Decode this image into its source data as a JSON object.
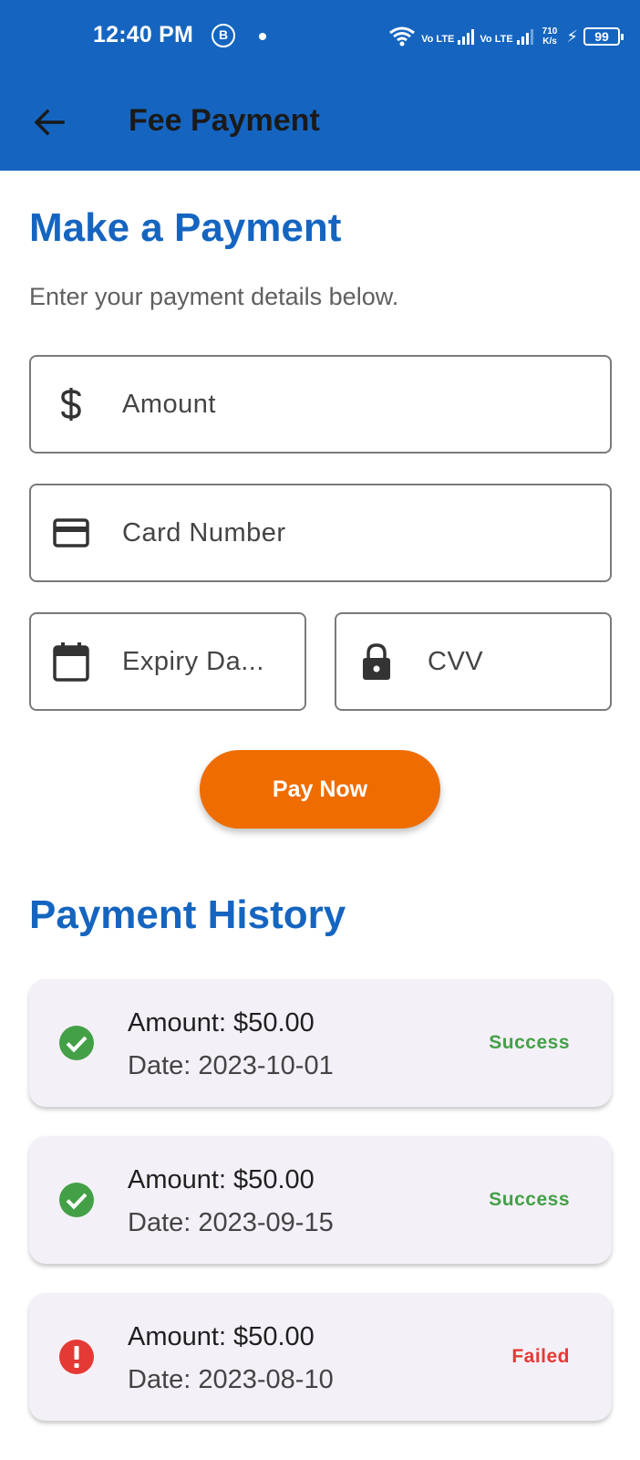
{
  "statusbar": {
    "time": "12:40 PM",
    "app_badge": "B",
    "sim1_label": "Vo LTE",
    "sim2_label": "Vo LTE",
    "speed_value": "710",
    "speed_unit": "K/s",
    "battery": "99"
  },
  "appbar": {
    "title": "Fee Payment",
    "back_icon": "arrow-back-icon",
    "color": "#1565c0"
  },
  "payment_form": {
    "title": "Make a Payment",
    "subtitle": "Enter your payment details below.",
    "amount_placeholder": "Amount",
    "card_number_placeholder": "Card Number",
    "expiry_placeholder": "Expiry Da...",
    "cvv_placeholder": "CVV",
    "amount_icon": "dollar-icon",
    "card_icon": "credit-card-icon",
    "expiry_icon": "calendar-icon",
    "cvv_icon": "lock-icon",
    "pay_button_label": "Pay Now",
    "pay_button_color": "#ef6c00"
  },
  "history": {
    "title": "Payment History",
    "items": [
      {
        "amount": "Amount: $50.00",
        "date": "Date: 2023-10-01",
        "status": "Success",
        "icon": "check-circle-icon",
        "color": "#43a047"
      },
      {
        "amount": "Amount: $50.00",
        "date": "Date: 2023-09-15",
        "status": "Success",
        "icon": "check-circle-icon",
        "color": "#43a047"
      },
      {
        "amount": "Amount: $50.00",
        "date": "Date: 2023-08-10",
        "status": "Failed",
        "icon": "error-circle-icon",
        "color": "#e53935"
      }
    ]
  }
}
